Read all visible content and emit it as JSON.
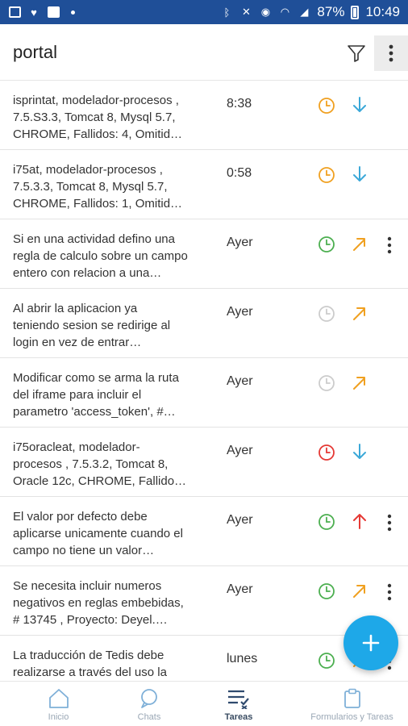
{
  "status_bar": {
    "battery": "87%",
    "time": "10:49"
  },
  "app_bar": {
    "title": "portal",
    "icons": [
      "filter-icon",
      "more-vert-icon"
    ]
  },
  "colors": {
    "status_bar_bg": "#1f4f98",
    "orange": "#f0a020",
    "green": "#4caf50",
    "red": "#e53935",
    "gray": "#cccccc",
    "blue": "#3ba8d8",
    "fab": "#1ea8e8"
  },
  "tasks": [
    {
      "text": "isprintat, modelador-procesos ,\n7.5.S3.3, Tomcat 8, Mysql 5.7,\nCHROME, Fallidos: 4, Omitid…",
      "time": "8:38",
      "clock": "orange",
      "arrow": "down",
      "menu": false
    },
    {
      "text": "i75at, modelador-procesos ,\n7.5.3.3, Tomcat 8, Mysql 5.7,\nCHROME, Fallidos: 1, Omitid…",
      "time": "0:58",
      "clock": "orange",
      "arrow": "down",
      "menu": false
    },
    {
      "text": "Si en una actividad defino una\nregla de calculo sobre un campo\nentero con relacion a una…",
      "time": "Ayer",
      "clock": "green",
      "arrow": "up-right",
      "menu": true
    },
    {
      "text": "Al abrir la aplicacion ya\nteniendo sesion se redirige al\nlogin en vez de entrar…",
      "time": "Ayer",
      "clock": "gray",
      "arrow": "up-right",
      "menu": false
    },
    {
      "text": "Modificar como se arma la ruta\ndel iframe para incluir el\nparametro 'access_token', #…",
      "time": "Ayer",
      "clock": "gray",
      "arrow": "up-right",
      "menu": false
    },
    {
      "text": "i75oracleat, modelador-\nprocesos , 7.5.3.2, Tomcat 8,\nOracle 12c, CHROME, Fallido…",
      "time": "Ayer",
      "clock": "red",
      "arrow": "down",
      "menu": false
    },
    {
      "text": "El valor por defecto debe\naplicarse unicamente cuando el\ncampo no tiene un valor…",
      "time": "Ayer",
      "clock": "green",
      "arrow": "up",
      "menu": true
    },
    {
      "text": "Se necesita incluir numeros\nnegativos en reglas embebidas,\n# 13745 , Proyecto: Deyel.…",
      "time": "Ayer",
      "clock": "green",
      "arrow": "up-right",
      "menu": true
    },
    {
      "text": "La traducción de Tedis debe\nrealizarse a través del uso la",
      "time": "lunes",
      "clock": "green",
      "arrow": "up-right",
      "menu": true
    }
  ],
  "fab": {
    "icon": "plus-icon"
  },
  "bottom_nav": [
    {
      "label": "Inicio",
      "icon": "home-icon",
      "active": false
    },
    {
      "label": "Chats",
      "icon": "chat-icon",
      "active": false
    },
    {
      "label": "Tareas",
      "icon": "tasks-icon",
      "active": true
    },
    {
      "label": "Formularios y Tareas",
      "icon": "clipboard-icon",
      "active": false
    }
  ]
}
